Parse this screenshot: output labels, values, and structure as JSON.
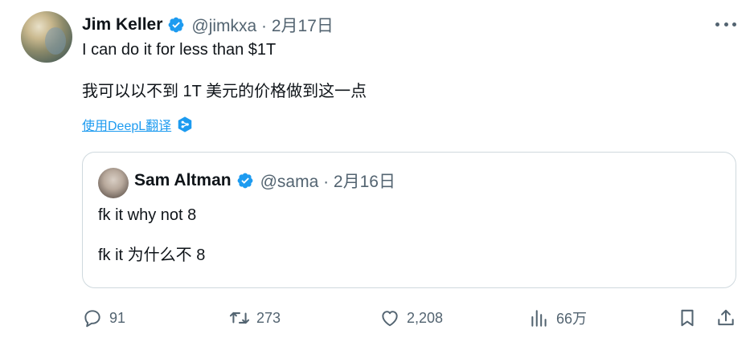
{
  "tweet": {
    "author_name": "Jim Keller",
    "handle_date": "@jimkxa · 2月17日",
    "text": "I can do it for less than $1T",
    "translated_text": "我可以以不到 1T 美元的价格做到这一点",
    "translate_link": "使用DeepL翻译"
  },
  "quoted_tweet": {
    "author_name": "Sam Altman",
    "handle_date": "@sama · 2月16日",
    "text": "fk it why not 8",
    "translated_text": "fk it 为什么不 8"
  },
  "actions": {
    "replies": "91",
    "retweets": "273",
    "likes": "2,208",
    "views": "66万"
  },
  "colors": {
    "verified": "#1d9bf0",
    "link": "#1d9bf0",
    "muted": "#536471",
    "border": "#cfd9de"
  },
  "icons": [
    "verified-badge-icon",
    "more-icon",
    "deepl-icon",
    "reply-icon",
    "retweet-icon",
    "like-icon",
    "views-icon",
    "bookmark-icon",
    "share-icon"
  ]
}
